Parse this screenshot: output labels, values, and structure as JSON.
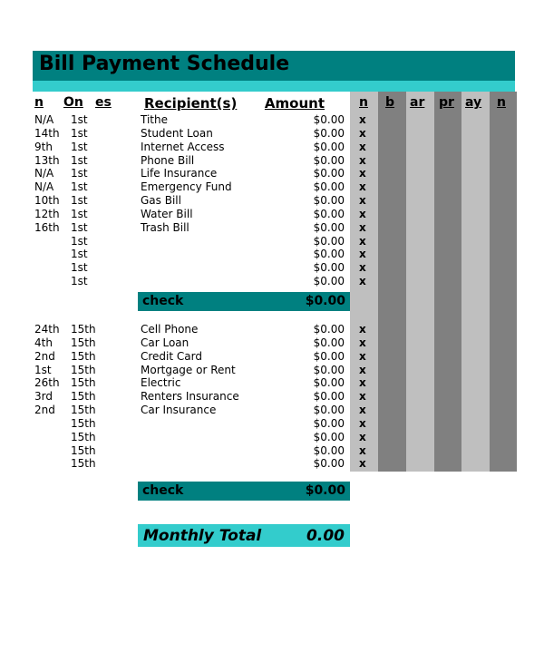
{
  "document": {
    "title": "Bill Payment Schedule"
  },
  "colors": {
    "title_band": "#008080",
    "accent_band": "#33cccc",
    "stripe_light": "#bfbfbf",
    "stripe_dark": "#808080",
    "text": "#000000"
  },
  "headers": {
    "when": "n",
    "due": "On",
    "notes": "es",
    "recipient": "Recipient(s)",
    "amount": "Amount",
    "g0": "n",
    "g1": "b",
    "g2": "ar",
    "g3": "pr",
    "g4": "ay",
    "g5": "n"
  },
  "sections": [
    {
      "id": "first-half",
      "rows": [
        {
          "when": "N/A",
          "due": "1st",
          "recipient": "Tithe",
          "amount": "$0.00",
          "mark": "x"
        },
        {
          "when": "14th",
          "due": "1st",
          "recipient": "Student Loan",
          "amount": "$0.00",
          "mark": "x"
        },
        {
          "when": "9th",
          "due": "1st",
          "recipient": "Internet Access",
          "amount": "$0.00",
          "mark": "x"
        },
        {
          "when": "13th",
          "due": "1st",
          "recipient": "Phone Bill",
          "amount": "$0.00",
          "mark": "x"
        },
        {
          "when": "N/A",
          "due": "1st",
          "recipient": "Life Insurance",
          "amount": "$0.00",
          "mark": "x"
        },
        {
          "when": "N/A",
          "due": "1st",
          "recipient": "Emergency Fund",
          "amount": "$0.00",
          "mark": "x"
        },
        {
          "when": "10th",
          "due": "1st",
          "recipient": "Gas Bill",
          "amount": "$0.00",
          "mark": "x"
        },
        {
          "when": "12th",
          "due": "1st",
          "recipient": "Water Bill",
          "amount": "$0.00",
          "mark": "x"
        },
        {
          "when": "16th",
          "due": "1st",
          "recipient": "Trash Bill",
          "amount": "$0.00",
          "mark": "x"
        },
        {
          "when": "",
          "due": "1st",
          "recipient": "",
          "amount": "$0.00",
          "mark": "x"
        },
        {
          "when": "",
          "due": "1st",
          "recipient": "",
          "amount": "$0.00",
          "mark": "x"
        },
        {
          "when": "",
          "due": "1st",
          "recipient": "",
          "amount": "$0.00",
          "mark": "x"
        },
        {
          "when": "",
          "due": "1st",
          "recipient": "",
          "amount": "$0.00",
          "mark": "x"
        }
      ],
      "check": {
        "label": "check",
        "amount": "$0.00"
      }
    },
    {
      "id": "second-half",
      "rows": [
        {
          "when": "24th",
          "due": "15th",
          "recipient": "Cell Phone",
          "amount": "$0.00",
          "mark": "x"
        },
        {
          "when": "4th",
          "due": "15th",
          "recipient": "Car Loan",
          "amount": "$0.00",
          "mark": "x"
        },
        {
          "when": "2nd",
          "due": "15th",
          "recipient": "Credit Card",
          "amount": "$0.00",
          "mark": "x"
        },
        {
          "when": "1st",
          "due": "15th",
          "recipient": "Mortgage or Rent",
          "amount": "$0.00",
          "mark": "x"
        },
        {
          "when": "26th",
          "due": "15th",
          "recipient": "Electric",
          "amount": "$0.00",
          "mark": "x"
        },
        {
          "when": "3rd",
          "due": "15th",
          "recipient": "Renters Insurance",
          "amount": "$0.00",
          "mark": "x"
        },
        {
          "when": "2nd",
          "due": "15th",
          "recipient": "Car Insurance",
          "amount": "$0.00",
          "mark": "x"
        },
        {
          "when": "",
          "due": "15th",
          "recipient": "",
          "amount": "$0.00",
          "mark": "x"
        },
        {
          "when": "",
          "due": "15th",
          "recipient": "",
          "amount": "$0.00",
          "mark": "x"
        },
        {
          "when": "",
          "due": "15th",
          "recipient": "",
          "amount": "$0.00",
          "mark": "x"
        },
        {
          "when": "",
          "due": "15th",
          "recipient": "",
          "amount": "$0.00",
          "mark": "x"
        }
      ],
      "check": {
        "label": "check",
        "amount": "$0.00"
      }
    }
  ],
  "total": {
    "label": "Monthly Total",
    "amount": "0.00"
  }
}
